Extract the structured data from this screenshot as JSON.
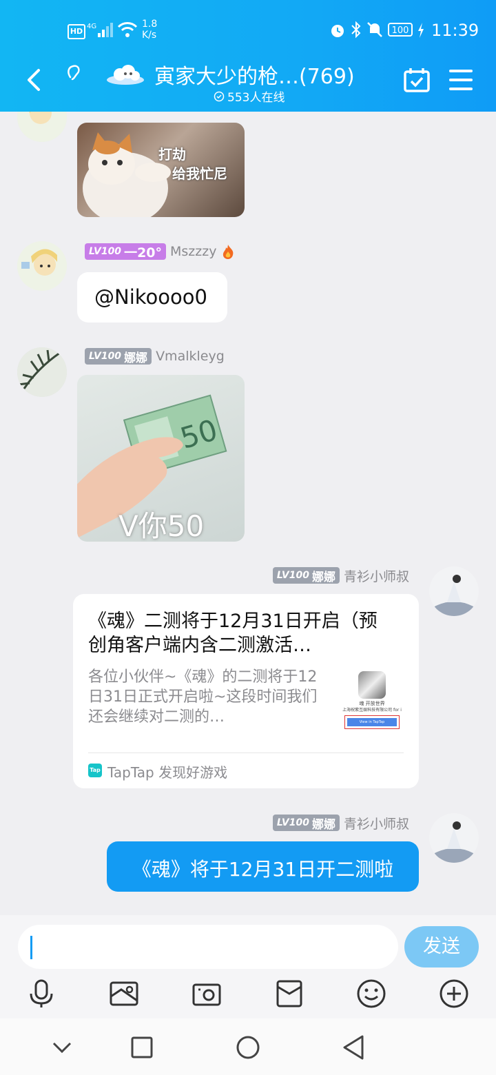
{
  "status_bar": {
    "time": "11:39",
    "network_speed_value": "1.8",
    "network_speed_unit": "K/s",
    "battery": "100"
  },
  "header": {
    "title": "寅家大少的枪…(769)",
    "online": "553人在线"
  },
  "messages": [
    {
      "image_text_line1": "打劫",
      "image_text_line2": "给我忙尼"
    },
    {
      "level": "LV100",
      "title": "一20°",
      "sender": "Mszzzy",
      "text": "@Nikoooo0"
    },
    {
      "level": "LV100",
      "title": "娜娜",
      "sender": "Vmalkleyg",
      "image_text": "V你50",
      "banknote_value": "50"
    },
    {
      "level": "LV100",
      "title": "娜娜",
      "sender": "青衫小师叔",
      "card": {
        "title": "《魂》二测将于12月31日开启（预创角客户端内含二测激活…",
        "desc": "各位小伙伴~《魂》的二测将于12日31日正式开启啦~这段时间我们还会继续对二测的…",
        "thumb_title": "魂 开放世界",
        "thumb_company": "上海祝紫互娱科技有限公司 for i",
        "thumb_button": "View in TapTap",
        "source_logo": "Tap",
        "source": "TapTap 发现好游戏"
      }
    },
    {
      "level": "LV100",
      "title": "娜娜",
      "sender": "青衫小师叔",
      "text": "《魂》将于12月31日开二测啦"
    }
  ],
  "composer": {
    "input_value": "",
    "send_label": "发送"
  },
  "toolbar_icons": [
    "microphone-icon",
    "image-icon",
    "camera-icon",
    "red-packet-icon",
    "emoji-icon",
    "plus-icon"
  ],
  "nav_icons": [
    "chevron-down-icon",
    "recents-square-icon",
    "home-circle-icon",
    "back-triangle-icon"
  ],
  "colors": {
    "header": "#12aef4",
    "my_bubble": "#139bf3",
    "send_button": "#7cc8f5",
    "badge": "#9ca2ad",
    "badge_purple": "#c77de8"
  }
}
